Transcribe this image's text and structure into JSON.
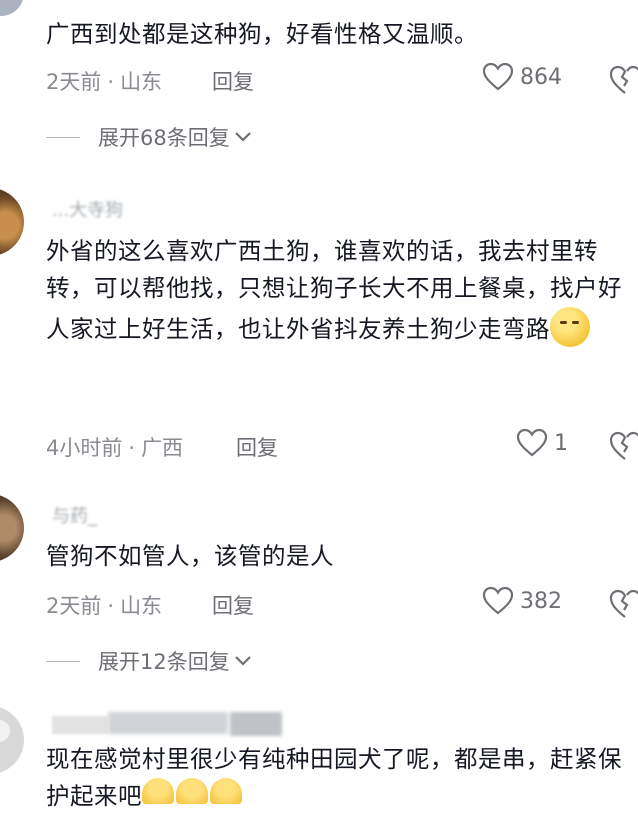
{
  "comments": [
    {
      "text": "广西到处都是这种狗，好看性格又温顺。",
      "time": "2天前",
      "location": "山东",
      "reply_label": "回复",
      "likes": "864",
      "expand_label": "展开68条回复"
    },
    {
      "username": "...大寺狗",
      "text": "外省的这么喜欢广西土狗，谁喜欢的话，我去村里转转，可以帮他找，只想让狗子长大不用上餐桌，找户好人家过上好生活，也让外省抖友养土狗少走弯路",
      "time": "4小时前",
      "location": "广西",
      "reply_label": "回复",
      "likes": "1"
    },
    {
      "username": "与药_",
      "text": "管狗不如管人，该管的是人",
      "time": "2天前",
      "location": "山东",
      "reply_label": "回复",
      "likes": "382",
      "expand_label": "展开12条回复"
    },
    {
      "text": "现在感觉村里很少有纯种田园犬了呢，都是串，赶紧保护起来吧"
    }
  ],
  "separator": "·",
  "colors": {
    "text_primary": "#161823",
    "text_secondary": "#8a8b91",
    "action": "#6e6f75"
  },
  "icons": [
    "heart-icon",
    "broken-heart-icon",
    "chevron-down-icon",
    "emoji-icon"
  ]
}
